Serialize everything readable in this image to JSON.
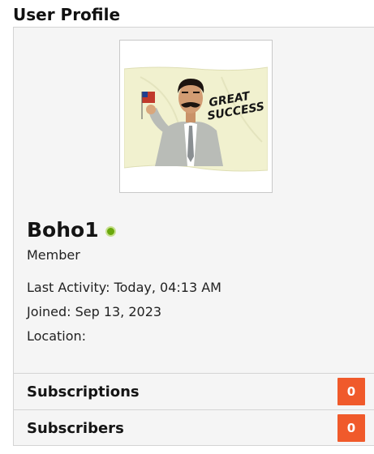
{
  "section": {
    "title": "User Profile"
  },
  "profile": {
    "username": "Boho1",
    "role": "Member",
    "online": true,
    "last_activity": "Last Activity: Today, 04:13 AM",
    "joined": "Joined: Sep 13, 2023",
    "location": "Location:",
    "avatar": {
      "caption_line1": "GREAT",
      "caption_line2": "SUCCESS"
    }
  },
  "stats": [
    {
      "label": "Subscriptions",
      "count": "0"
    },
    {
      "label": "Subscribers",
      "count": "0"
    }
  ],
  "colors": {
    "badge": "#f05a2b",
    "online": "#6aa80c",
    "panel_bg": "#f5f5f5"
  }
}
